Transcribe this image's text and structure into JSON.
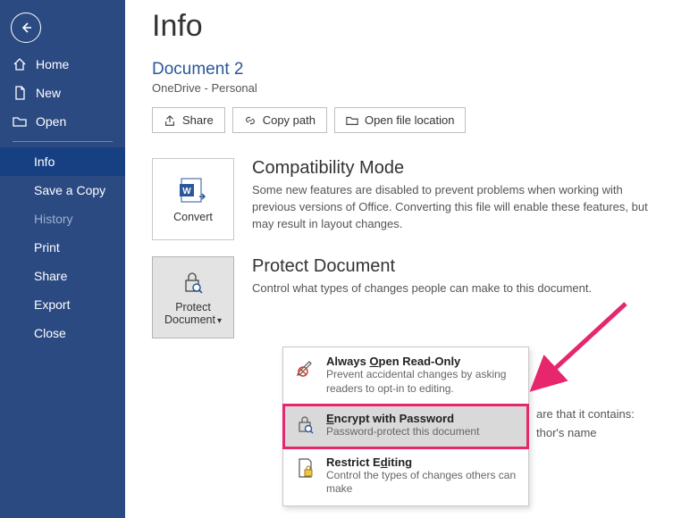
{
  "nav": {
    "home": "Home",
    "new": "New",
    "open": "Open",
    "info": "Info",
    "save_copy": "Save a Copy",
    "history": "History",
    "print": "Print",
    "share": "Share",
    "export": "Export",
    "close": "Close"
  },
  "page": {
    "title": "Info",
    "doc_title": "Document 2",
    "doc_location": "OneDrive - Personal"
  },
  "actions": {
    "share": "Share",
    "copy_path": "Copy path",
    "open_location": "Open file location"
  },
  "compat": {
    "button": "Convert",
    "title": "Compatibility Mode",
    "desc": "Some new features are disabled to prevent problems when working with previous versions of Office. Converting this file will enable these features, but may result in layout changes."
  },
  "protect": {
    "button": "Protect Document",
    "title": "Protect Document",
    "desc": "Control what types of changes people can make to this document."
  },
  "dropdown": {
    "readonly": {
      "title_pre": "Always ",
      "title_u": "O",
      "title_post": "pen Read-Only",
      "desc": "Prevent accidental changes by asking readers to opt-in to editing."
    },
    "encrypt": {
      "title_pre": "",
      "title_u": "E",
      "title_post": "ncrypt with Password",
      "desc": "Password-protect this document"
    },
    "restrict": {
      "title_pre": "Restrict E",
      "title_u": "d",
      "title_post": "iting",
      "desc": "Control the types of changes others can make"
    }
  },
  "behind": {
    "line1": "are that it contains:",
    "line2": "thor's name"
  }
}
